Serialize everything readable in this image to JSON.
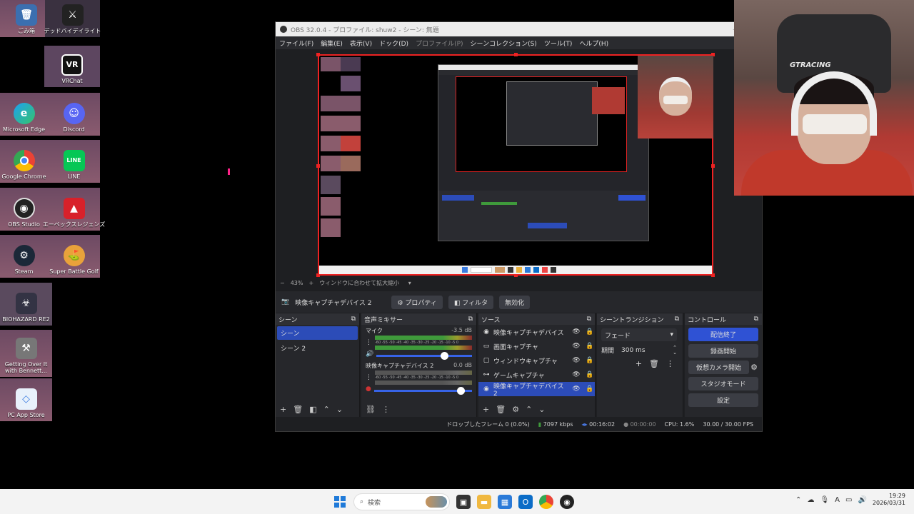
{
  "desktop": {
    "icons": [
      {
        "label": "ごみ箱"
      },
      {
        "label": "デッドバイデイライト"
      },
      {
        "label": "VRChat"
      },
      {
        "label": "Microsoft Edge"
      },
      {
        "label": "Discord"
      },
      {
        "label": "Google Chrome"
      },
      {
        "label": "LINE"
      },
      {
        "label": "OBS Studio"
      },
      {
        "label": "エーペックスレジェンズ"
      },
      {
        "label": "Steam"
      },
      {
        "label": "Super Battle Golf"
      },
      {
        "label": "BIOHAZARD RE2"
      },
      {
        "label": "Getting Over It with Bennett..."
      },
      {
        "label": "PC App Store"
      }
    ]
  },
  "webcam": {
    "brand_text": "GTRACING"
  },
  "obs": {
    "title": "OBS 32.0.4 - プロファイル: shuw2 - シーン: 無題",
    "menu": [
      "ファイル(F)",
      "編集(E)",
      "表示(V)",
      "ドック(D)",
      "プロファイル(P)",
      "シーンコレクション(S)",
      "ツール(T)",
      "ヘルプ(H)"
    ],
    "zoom": {
      "minus": "−",
      "percent": "43%",
      "plus": "+",
      "fit": "ウィンドウに合わせて拡大縮小"
    },
    "source_bar": {
      "name": "映像キャプチャデバイス 2",
      "properties": "プロパティ",
      "filters": "フィルタ",
      "deactivate": "無効化"
    },
    "scenes": {
      "header": "シーン",
      "items": [
        "シーン",
        "シーン 2"
      ]
    },
    "mixer": {
      "header": "音声ミキサー",
      "channels": [
        {
          "name": "マイク",
          "db": "-3.5 dB",
          "scale": "-60 -55 -50 -45 -40 -35 -30 -25 -20 -15 -10 -5 0"
        },
        {
          "name": "映像キャプチャデバイス 2",
          "db": "0.0 dB",
          "scale": "-60 -55 -50 -45 -40 -35 -30 -25 -20 -15 -10 -5 0"
        }
      ]
    },
    "sources": {
      "header": "ソース",
      "items": [
        {
          "name": "映像キャプチャデバイス",
          "icon": "camera-icon"
        },
        {
          "name": "画面キャプチャ",
          "icon": "monitor-icon"
        },
        {
          "name": "ウィンドウキャプチャ",
          "icon": "window-icon"
        },
        {
          "name": "ゲームキャプチャ",
          "icon": "gamepad-icon"
        },
        {
          "name": "映像キャプチャデバイス 2",
          "icon": "camera-icon"
        }
      ]
    },
    "transitions": {
      "header": "シーントランジション",
      "type": "フェード",
      "duration_label": "期間",
      "duration": "300 ms"
    },
    "controls": {
      "header": "コントロール",
      "stop_stream": "配信終了",
      "start_recording": "録画開始",
      "virtual_camera": "仮想カメラ開始",
      "studio_mode": "スタジオモード",
      "settings": "設定"
    },
    "status": {
      "dropped": "ドロップしたフレーム 0 (0.0%)",
      "bitrate": "7097 kbps",
      "stream_time": "00:16:02",
      "record_time": "00:00:00",
      "cpu": "CPU: 1.6%",
      "fps": "30.00 / 30.00 FPS"
    }
  },
  "taskbar": {
    "search_placeholder": "検索",
    "time": "19:29",
    "date": "2026/03/31"
  },
  "colors": {
    "accent": "#2f52d4",
    "selection": "#2c4cb8",
    "preview_border": "#e22222"
  }
}
